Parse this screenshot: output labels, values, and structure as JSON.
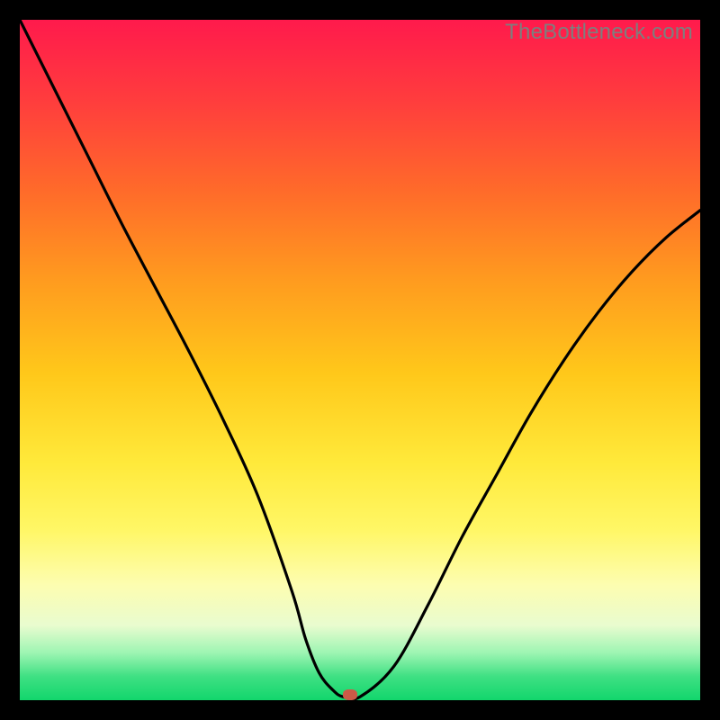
{
  "watermark": "TheBottleneck.com",
  "chart_data": {
    "type": "line",
    "title": "",
    "xlabel": "",
    "ylabel": "",
    "xlim": [
      0,
      100
    ],
    "ylim": [
      0,
      100
    ],
    "x": [
      0,
      5,
      10,
      15,
      20,
      25,
      30,
      35,
      40,
      42,
      44,
      46,
      47.5,
      50,
      55,
      60,
      65,
      70,
      75,
      80,
      85,
      90,
      95,
      100
    ],
    "values": [
      100,
      90,
      80,
      70,
      60.5,
      51,
      41,
      30,
      16,
      9,
      4,
      1.5,
      0.5,
      0.5,
      5,
      14,
      24,
      33,
      42,
      50,
      57,
      63,
      68,
      72
    ],
    "marker": {
      "x": 48.5,
      "y": 0.8
    },
    "gradient_stops": [
      {
        "pos": 0,
        "color": "#ff1a4c"
      },
      {
        "pos": 25,
        "color": "#ff6a2a"
      },
      {
        "pos": 52,
        "color": "#ffc81a"
      },
      {
        "pos": 75,
        "color": "#fff766"
      },
      {
        "pos": 93,
        "color": "#9ef5b3"
      },
      {
        "pos": 100,
        "color": "#12d66c"
      }
    ]
  }
}
